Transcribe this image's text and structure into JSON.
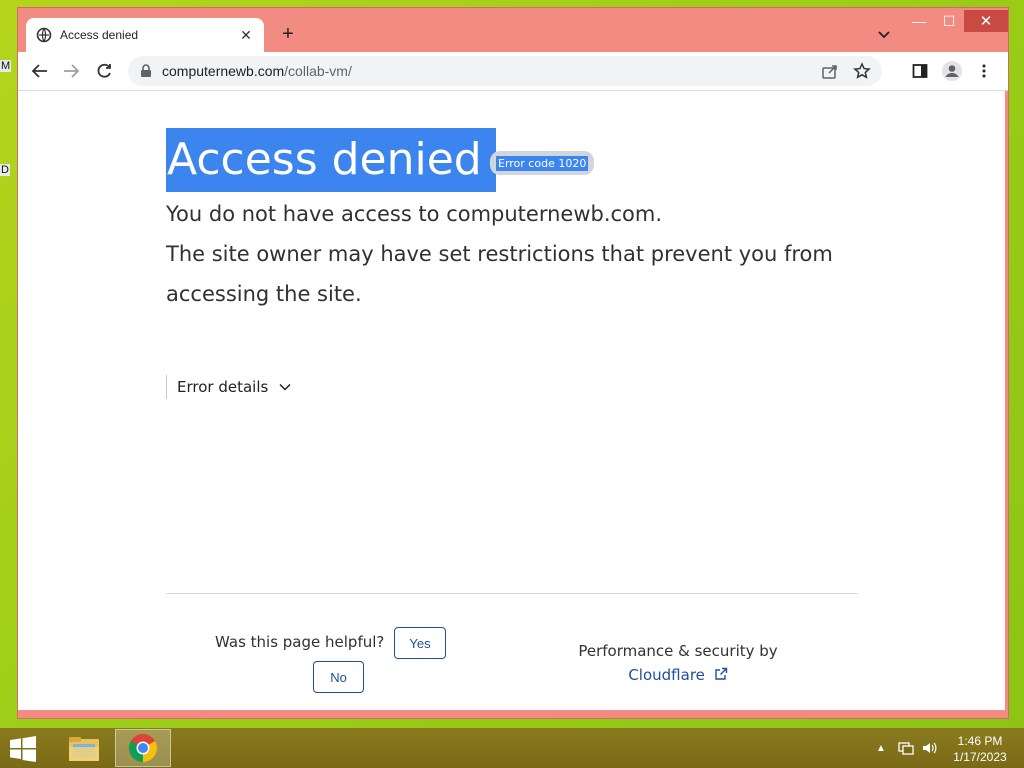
{
  "desktop": {
    "fragments": [
      "M",
      "D"
    ]
  },
  "browser": {
    "tab": {
      "title": "Access denied"
    },
    "window_controls": {
      "minimize": "—",
      "maximize": "☐",
      "close": "✕"
    },
    "address_bar": {
      "domain": "computernewb.com",
      "path": "/collab-vm/"
    }
  },
  "page": {
    "heading": "Access denied",
    "error_code": "Error code 1020",
    "line1": "You do not have access to computernewb.com.",
    "line2": "The site owner may have set restrictions that prevent you from accessing the site.",
    "error_details_label": "Error details",
    "helpful_question": "Was this page helpful?",
    "yes_label": "Yes",
    "no_label": "No",
    "perf_label": "Performance & security by",
    "cloudflare_label": "Cloudflare"
  },
  "taskbar": {
    "time": "1:46 PM",
    "date": "1/17/2023"
  },
  "colors": {
    "titlebar": "#f28b82",
    "selection": "#3c85ee",
    "link": "#1e4fa0",
    "taskbar": "#7a6a16"
  }
}
